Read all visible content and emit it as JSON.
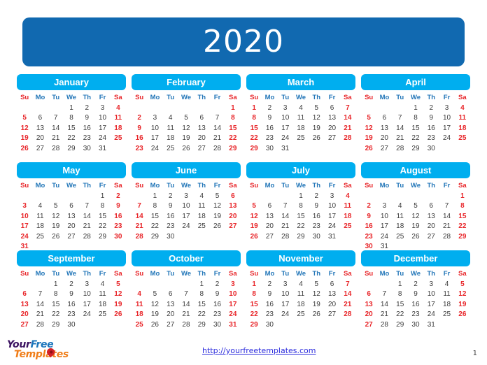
{
  "banner": {
    "year": "2020",
    "bg_color": "#1169b0",
    "text_color": "#ffffff"
  },
  "theme": {
    "month_header_color": "#00aeef",
    "weekday_color": "#2276b8",
    "weekend_color": "#e8262a",
    "day_color": "#3b3b3b",
    "link_color": "#2b2bdd"
  },
  "weekday_headers": [
    "Su",
    "Mo",
    "Tu",
    "We",
    "Th",
    "Fr",
    "Sa"
  ],
  "months": [
    {
      "name": "January",
      "first_weekday_index": 3,
      "days_in_month": 31,
      "weeks": [
        [
          "",
          "",
          "",
          "1",
          "2",
          "3",
          "4"
        ],
        [
          "5",
          "6",
          "7",
          "8",
          "9",
          "10",
          "11"
        ],
        [
          "12",
          "13",
          "14",
          "15",
          "16",
          "17",
          "18"
        ],
        [
          "19",
          "20",
          "21",
          "22",
          "23",
          "24",
          "25"
        ],
        [
          "26",
          "27",
          "28",
          "29",
          "30",
          "31",
          ""
        ]
      ]
    },
    {
      "name": "February",
      "first_weekday_index": 6,
      "days_in_month": 29,
      "weeks": [
        [
          "",
          "",
          "",
          "",
          "",
          "",
          "1"
        ],
        [
          "2",
          "3",
          "4",
          "5",
          "6",
          "7",
          "8"
        ],
        [
          "9",
          "10",
          "11",
          "12",
          "13",
          "14",
          "15"
        ],
        [
          "16",
          "17",
          "18",
          "19",
          "20",
          "21",
          "22"
        ],
        [
          "23",
          "24",
          "25",
          "26",
          "27",
          "28",
          "29"
        ]
      ]
    },
    {
      "name": "March",
      "first_weekday_index": 0,
      "days_in_month": 31,
      "weeks": [
        [
          "1",
          "2",
          "3",
          "4",
          "5",
          "6",
          "7"
        ],
        [
          "8",
          "9",
          "10",
          "11",
          "12",
          "13",
          "14"
        ],
        [
          "15",
          "16",
          "17",
          "18",
          "19",
          "20",
          "21"
        ],
        [
          "22",
          "23",
          "24",
          "25",
          "26",
          "27",
          "28"
        ],
        [
          "29",
          "30",
          "31",
          "",
          "",
          "",
          ""
        ]
      ]
    },
    {
      "name": "April",
      "first_weekday_index": 3,
      "days_in_month": 30,
      "weeks": [
        [
          "",
          "",
          "",
          "1",
          "2",
          "3",
          "4"
        ],
        [
          "5",
          "6",
          "7",
          "8",
          "9",
          "10",
          "11"
        ],
        [
          "12",
          "13",
          "14",
          "15",
          "16",
          "17",
          "18"
        ],
        [
          "19",
          "20",
          "21",
          "22",
          "23",
          "24",
          "25"
        ],
        [
          "26",
          "27",
          "28",
          "29",
          "30",
          "",
          ""
        ]
      ]
    },
    {
      "name": "May",
      "first_weekday_index": 5,
      "days_in_month": 31,
      "weeks": [
        [
          "",
          "",
          "",
          "",
          "",
          "1",
          "2"
        ],
        [
          "3",
          "4",
          "5",
          "6",
          "7",
          "8",
          "9"
        ],
        [
          "10",
          "11",
          "12",
          "13",
          "14",
          "15",
          "16"
        ],
        [
          "17",
          "18",
          "19",
          "20",
          "21",
          "22",
          "23"
        ],
        [
          "24",
          "25",
          "26",
          "27",
          "28",
          "29",
          "30"
        ],
        [
          "31",
          "",
          "",
          "",
          "",
          "",
          ""
        ]
      ]
    },
    {
      "name": "June",
      "first_weekday_index": 1,
      "days_in_month": 30,
      "weeks": [
        [
          "",
          "1",
          "2",
          "3",
          "4",
          "5",
          "6"
        ],
        [
          "7",
          "8",
          "9",
          "10",
          "11",
          "12",
          "13"
        ],
        [
          "14",
          "15",
          "16",
          "17",
          "18",
          "19",
          "20"
        ],
        [
          "21",
          "22",
          "23",
          "24",
          "25",
          "26",
          "27"
        ],
        [
          "28",
          "29",
          "30",
          "",
          "",
          "",
          ""
        ]
      ]
    },
    {
      "name": "July",
      "first_weekday_index": 3,
      "days_in_month": 31,
      "weeks": [
        [
          "",
          "",
          "",
          "1",
          "2",
          "3",
          "4"
        ],
        [
          "5",
          "6",
          "7",
          "8",
          "9",
          "10",
          "11"
        ],
        [
          "12",
          "13",
          "14",
          "15",
          "16",
          "17",
          "18"
        ],
        [
          "19",
          "20",
          "21",
          "22",
          "23",
          "24",
          "25"
        ],
        [
          "26",
          "27",
          "28",
          "29",
          "30",
          "31",
          ""
        ]
      ]
    },
    {
      "name": "August",
      "first_weekday_index": 6,
      "days_in_month": 31,
      "weeks": [
        [
          "",
          "",
          "",
          "",
          "",
          "",
          "1"
        ],
        [
          "2",
          "3",
          "4",
          "5",
          "6",
          "7",
          "8"
        ],
        [
          "9",
          "10",
          "11",
          "12",
          "13",
          "14",
          "15"
        ],
        [
          "16",
          "17",
          "18",
          "19",
          "20",
          "21",
          "22"
        ],
        [
          "23",
          "24",
          "25",
          "26",
          "27",
          "28",
          "29"
        ],
        [
          "30",
          "31",
          "",
          "",
          "",
          "",
          ""
        ]
      ]
    },
    {
      "name": "September",
      "first_weekday_index": 2,
      "days_in_month": 30,
      "weeks": [
        [
          "",
          "",
          "1",
          "2",
          "3",
          "4",
          "5"
        ],
        [
          "6",
          "7",
          "8",
          "9",
          "10",
          "11",
          "12"
        ],
        [
          "13",
          "14",
          "15",
          "16",
          "17",
          "18",
          "19"
        ],
        [
          "20",
          "21",
          "22",
          "23",
          "24",
          "25",
          "26"
        ],
        [
          "27",
          "28",
          "29",
          "30",
          "",
          "",
          ""
        ]
      ]
    },
    {
      "name": "October",
      "first_weekday_index": 4,
      "days_in_month": 31,
      "weeks": [
        [
          "",
          "",
          "",
          "",
          "1",
          "2",
          "3"
        ],
        [
          "4",
          "5",
          "6",
          "7",
          "8",
          "9",
          "10"
        ],
        [
          "11",
          "12",
          "13",
          "14",
          "15",
          "16",
          "17"
        ],
        [
          "18",
          "19",
          "20",
          "21",
          "22",
          "23",
          "24"
        ],
        [
          "25",
          "26",
          "27",
          "28",
          "29",
          "30",
          "31"
        ]
      ]
    },
    {
      "name": "November",
      "first_weekday_index": 0,
      "days_in_month": 30,
      "weeks": [
        [
          "1",
          "2",
          "3",
          "4",
          "5",
          "6",
          "7"
        ],
        [
          "8",
          "9",
          "10",
          "11",
          "12",
          "13",
          "14"
        ],
        [
          "15",
          "16",
          "17",
          "18",
          "19",
          "20",
          "21"
        ],
        [
          "22",
          "23",
          "24",
          "25",
          "26",
          "27",
          "28"
        ],
        [
          "29",
          "30",
          "",
          "",
          "",
          "",
          ""
        ]
      ]
    },
    {
      "name": "December",
      "first_weekday_index": 2,
      "days_in_month": 31,
      "weeks": [
        [
          "",
          "",
          "1",
          "2",
          "3",
          "4",
          "5"
        ],
        [
          "6",
          "7",
          "8",
          "9",
          "10",
          "11",
          "12"
        ],
        [
          "13",
          "14",
          "15",
          "16",
          "17",
          "18",
          "19"
        ],
        [
          "20",
          "21",
          "22",
          "23",
          "24",
          "25",
          "26"
        ],
        [
          "27",
          "28",
          "29",
          "30",
          "31",
          "",
          ""
        ]
      ]
    }
  ],
  "footer": {
    "logo": {
      "line1_part1": "Your",
      "line1_part2": "Free",
      "line2": "Templates"
    },
    "url": "http://yourfreetemplates.com",
    "page_number": "1"
  }
}
